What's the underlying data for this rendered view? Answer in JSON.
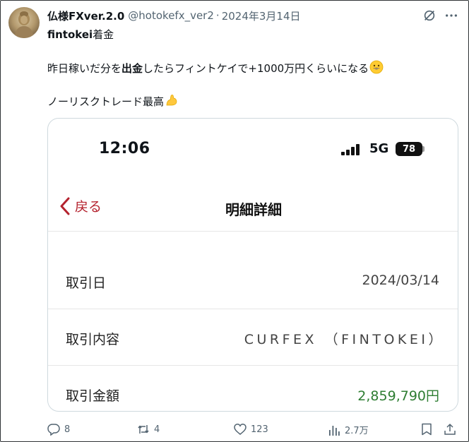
{
  "tweet": {
    "author_name": "仏様FXver.2.0",
    "handle": "@hotokefx_ver2",
    "separator": "·",
    "date": "2024年3月14日",
    "line1_bold": "fintokei",
    "line1_rest": "着金",
    "line2_before": "昨日稼いだ分を",
    "line2_bold": "出金",
    "line2_after": "したらフィントケイで+1000万円くらいになる",
    "line3": "ノーリスクトレード最高",
    "icons": {
      "avatar": "buddha-avatar",
      "grok": "grok-icon",
      "more": "more-icon",
      "emoji_line2": "grinning-face-emoji",
      "emoji_line3": "flexed-biceps-emoji"
    }
  },
  "card": {
    "status_time": "12:06",
    "network": "5G",
    "battery": "78",
    "back_label": "戻る",
    "title": "明細詳細",
    "rows": [
      {
        "label": "取引日",
        "value": "2024/03/14"
      },
      {
        "label": "取引内容",
        "value": "CURFEX （FINTOKEI）"
      },
      {
        "label": "取引金額",
        "value": "2,859,790円"
      }
    ],
    "colors": {
      "accent_red": "#b4222e",
      "amount_green": "#2e7d32"
    }
  },
  "actions": {
    "replies": "8",
    "retweets": "4",
    "likes": "123",
    "views": "2.7万"
  }
}
